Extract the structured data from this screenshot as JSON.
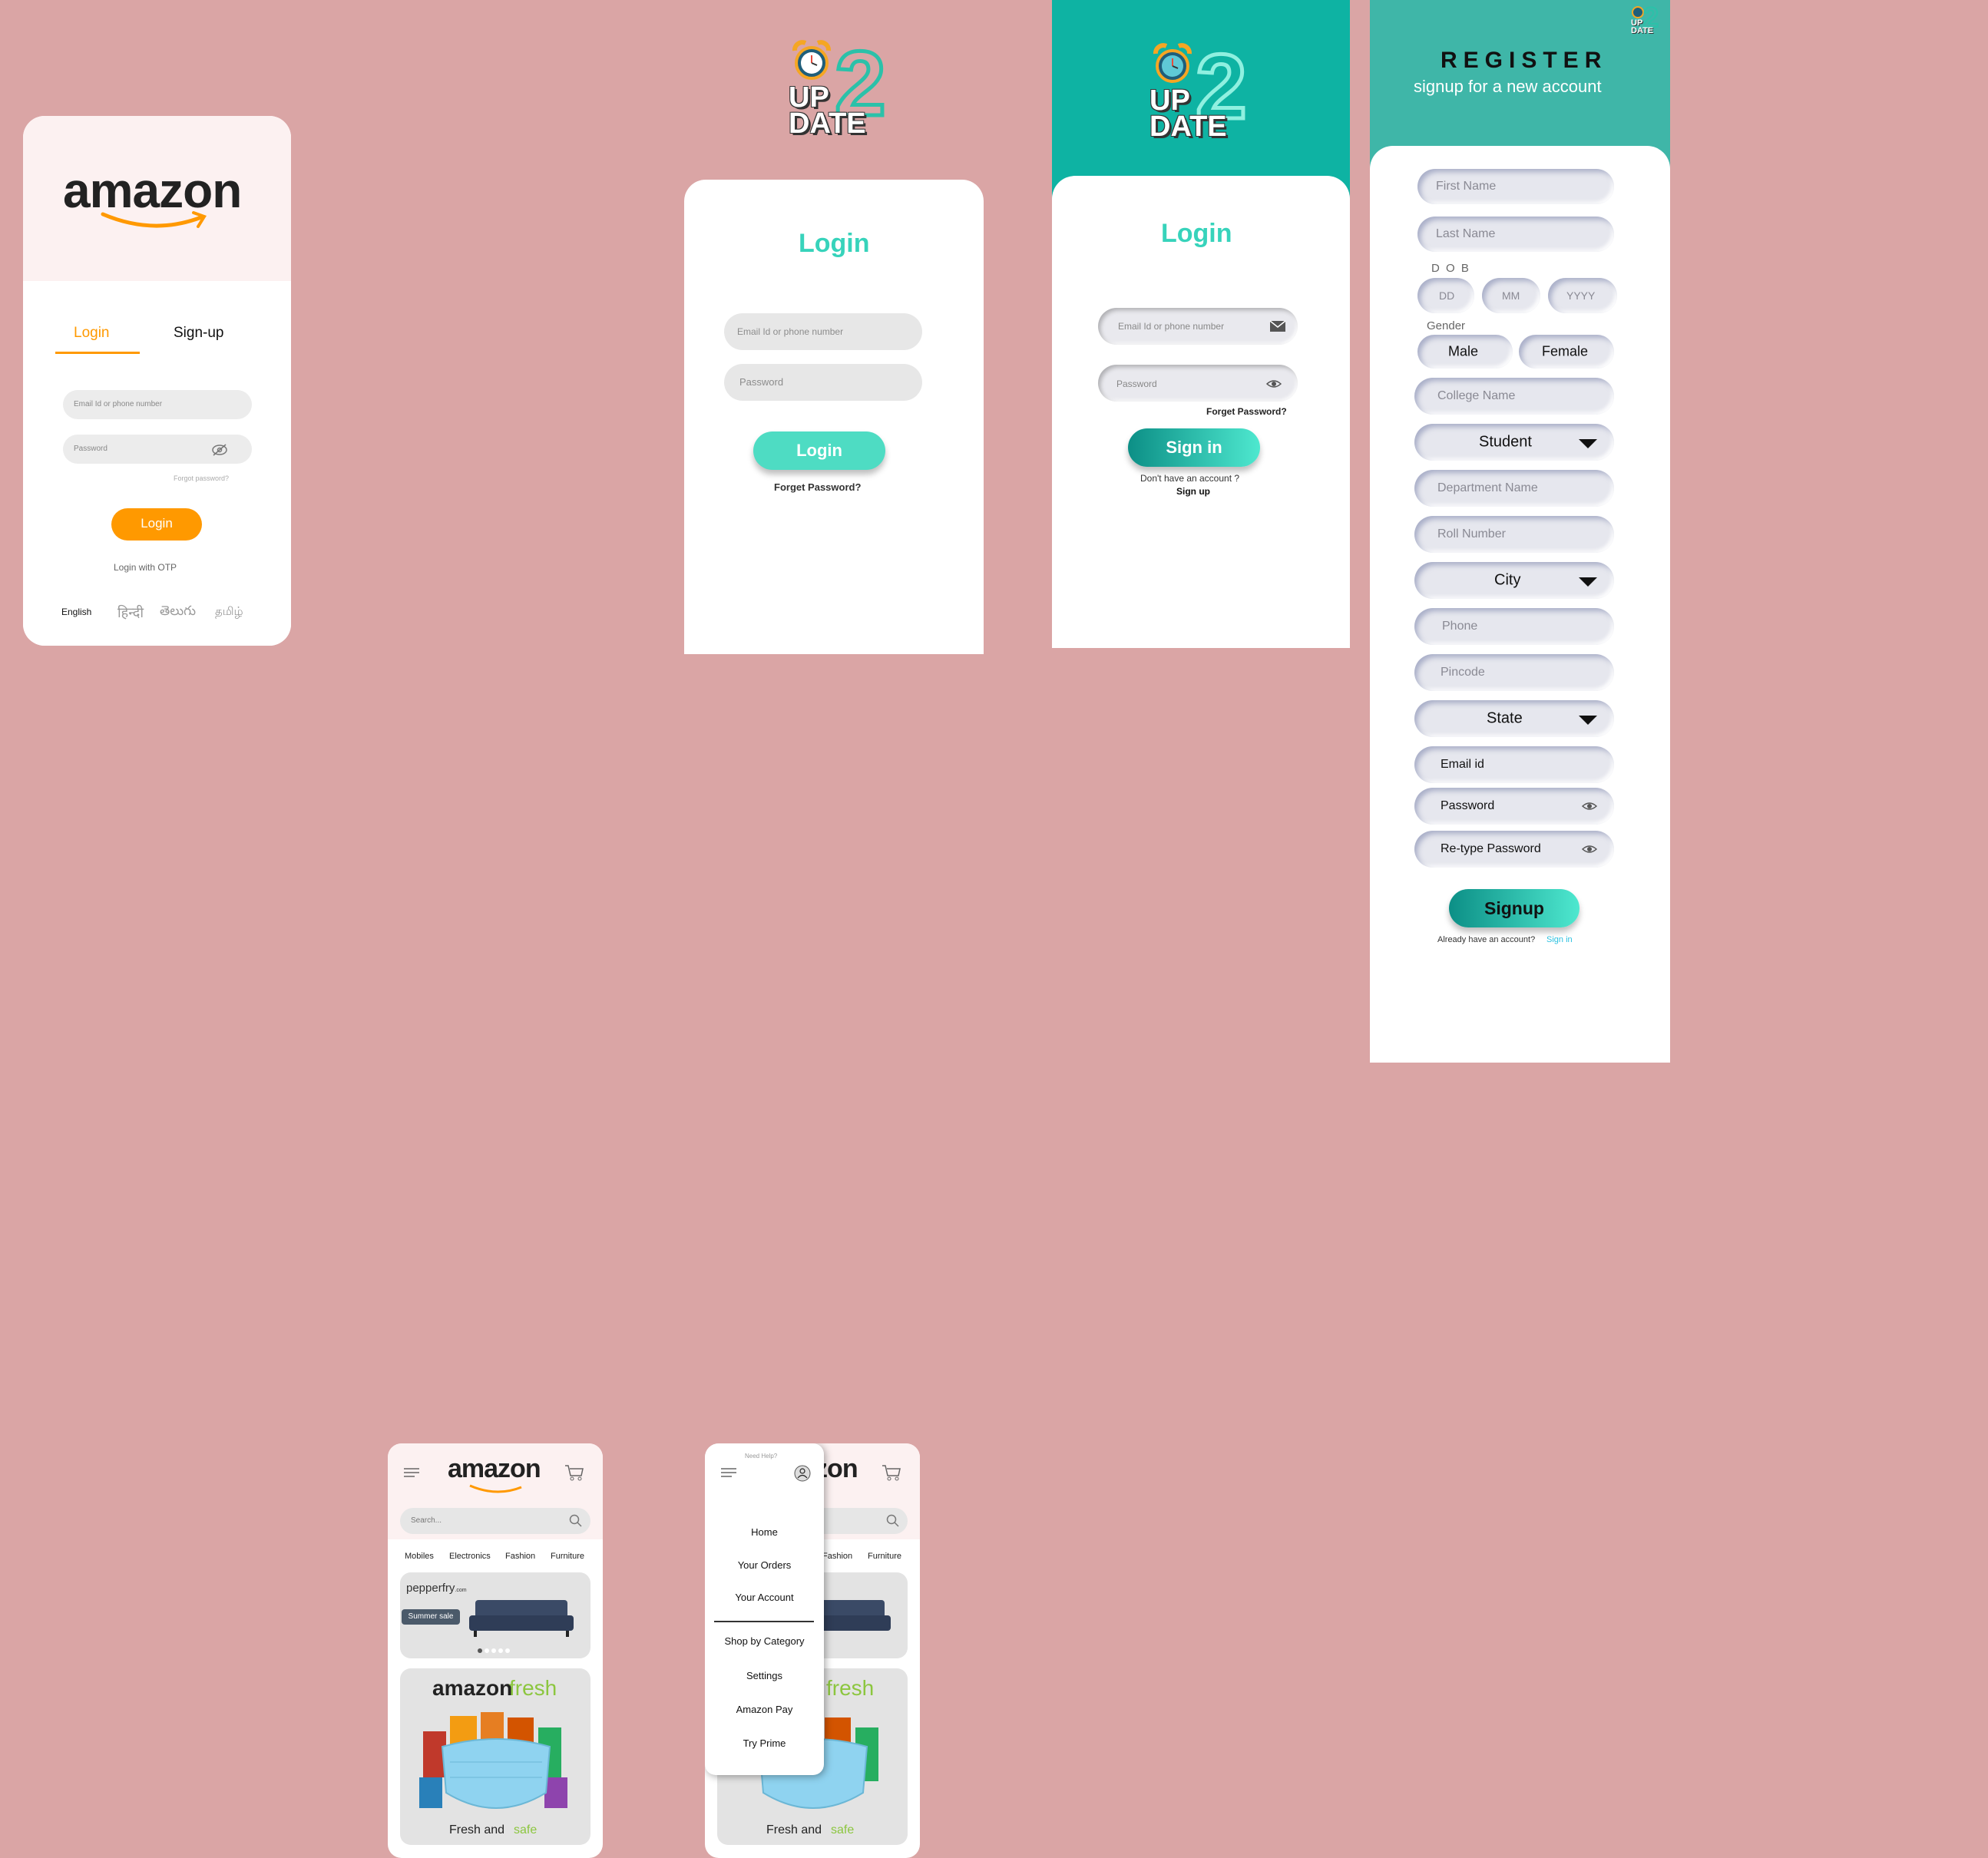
{
  "amazon_login": {
    "logo": "amazon",
    "tabs": {
      "login": "Login",
      "signup": "Sign-up"
    },
    "email_placeholder": "Email Id or phone number",
    "password_placeholder": "Password",
    "forgot": "Forgot password?",
    "login_button": "Login",
    "otp": "Login with OTP",
    "languages": [
      "English",
      "हिन्दी",
      "తెలుగు",
      "தமிழ்"
    ]
  },
  "update_logo": {
    "digit": "2",
    "line1": "UP",
    "line2": "DATE"
  },
  "update_login_plain": {
    "title": "Login",
    "email_placeholder": "Email Id or phone number",
    "password_placeholder": "Password",
    "login_button": "Login",
    "forgot": "Forget Password?"
  },
  "update_login_teal": {
    "title": "Login",
    "email_placeholder": "Email Id or phone number",
    "password_placeholder": "Password",
    "forgot": "Forget Password?",
    "signin_button": "Sign in",
    "no_account": "Don't have an account ?",
    "signup_link": "Sign up"
  },
  "register": {
    "title": "REGISTER",
    "subtitle": "signup for a new account",
    "first_name": "First Name",
    "last_name": "Last Name",
    "dob_label": "D O B",
    "dd": "DD",
    "mm": "MM",
    "yyyy": "YYYY",
    "gender_label": "Gender",
    "male": "Male",
    "female": "Female",
    "college": "College Name",
    "role_select": "Student",
    "department": "Department Name",
    "roll": "Roll Number",
    "city_select": "City",
    "phone": "Phone",
    "pincode": "Pincode",
    "state_select": "State",
    "email": "Email id",
    "password": "Password",
    "retype": "Re-type Password",
    "signup_button": "Signup",
    "already": "Already have an account?",
    "signin_link": "Sign in"
  },
  "amazon_home": {
    "logo": "amazon",
    "search_placeholder": "Search...",
    "categories": [
      "Mobiles",
      "Electronics",
      "Fashion",
      "Furniture"
    ],
    "pepperfry": "pepperfry",
    "pepperfry_suffix": ".com",
    "summer_sale": "Summer sale",
    "fresh_logo_a": "amazon",
    "fresh_logo_b": "fresh",
    "fresh_caption_a": "Fresh and",
    "fresh_caption_b": "safe"
  },
  "drawer": {
    "need_help": "Need Help?",
    "logo_fragment": "zon",
    "items_top": [
      "Home",
      "Your Orders",
      "Your Account"
    ],
    "items_bottom": [
      "Shop by Category",
      "Settings",
      "Amazon Pay",
      "Try Prime"
    ]
  },
  "colors": {
    "background": "#daa5a5",
    "amazon_orange": "#ff9900",
    "teal": "#4edcc3",
    "teal_dark": "#0eb3a3",
    "fresh_green": "#8cc63f"
  }
}
